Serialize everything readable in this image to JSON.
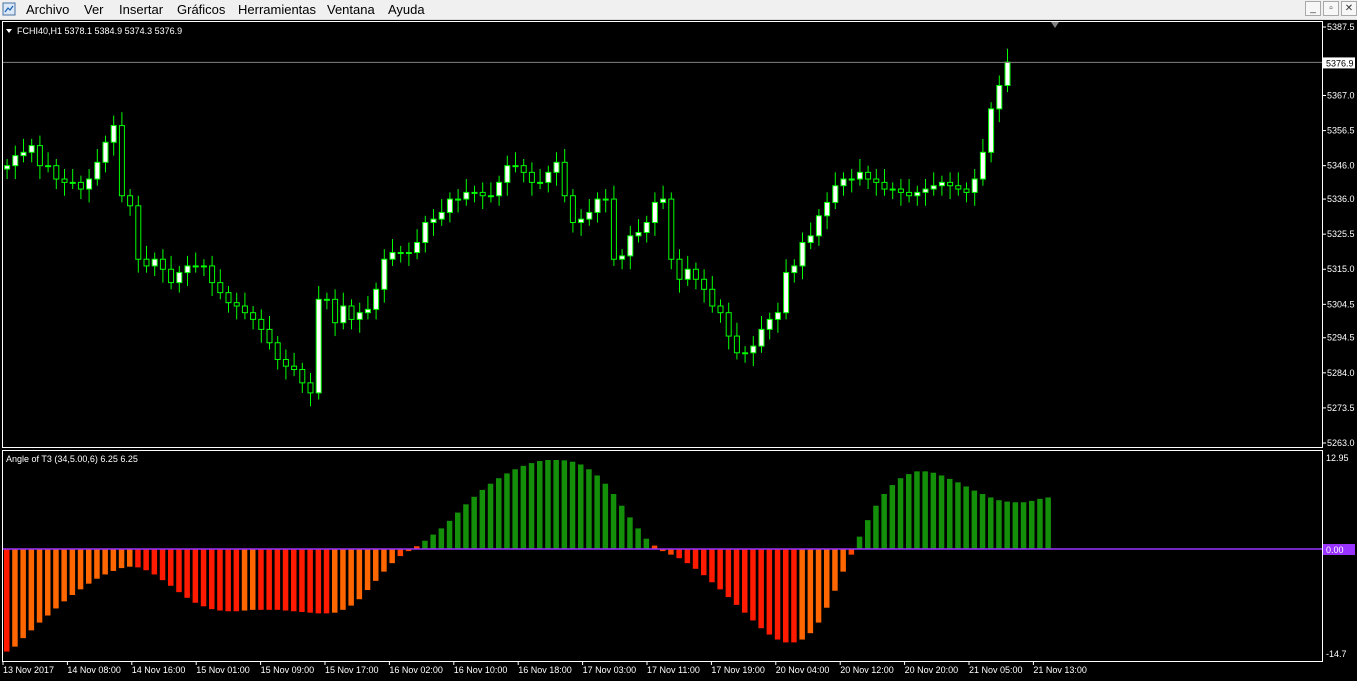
{
  "menu": {
    "items": [
      "Archivo",
      "Ver",
      "Insertar",
      "Gráficos",
      "Herramientas",
      "Ventana",
      "Ayuda"
    ]
  },
  "window_controls": {
    "minimize": "_",
    "restore": "▫",
    "close": "✕"
  },
  "colors": {
    "background": "#000000",
    "bull_candle": "#ffffff",
    "bear_candle": "#000000",
    "candle_outline": "#00ff00",
    "bar_dark_red": "#ff1a00",
    "bar_orange_red": "#ff4500",
    "bar_orange": "#ff6600",
    "bar_green": "#138f0a",
    "zero_line": "#9933ff",
    "grid_line": "#ffffff"
  },
  "price_chart": {
    "symbol_label": "FCHI40,H1  5378.1 5384.9 5374.3 5376.9",
    "current_price": "5376.9",
    "price_labels": [
      "5387.5",
      "5367.0",
      "5356.5",
      "5346.0",
      "5336.0",
      "5325.5",
      "5315.0",
      "5304.5",
      "5294.5",
      "5284.0",
      "5273.5",
      "5263.0"
    ]
  },
  "indicator": {
    "label": "Angle of T3 (34,5.00,6) 6.25 6.25",
    "max_label": "12.95",
    "zero_label": "0.00",
    "min_label": "-14.7"
  },
  "time_labels": [
    "13 Nov 2017",
    "14 Nov 08:00",
    "14 Nov 16:00",
    "15 Nov 01:00",
    "15 Nov 09:00",
    "15 Nov 17:00",
    "16 Nov 02:00",
    "16 Nov 10:00",
    "16 Nov 18:00",
    "17 Nov 03:00",
    "17 Nov 11:00",
    "17 Nov 19:00",
    "20 Nov 04:00",
    "20 Nov 12:00",
    "20 Nov 20:00",
    "21 Nov 05:00",
    "21 Nov 13:00"
  ],
  "chart_data": [
    {
      "type": "candlestick",
      "series": [
        {
          "name": "FCHI40,H1",
          "close": [
            5346,
            5349,
            5350,
            5352,
            5346,
            5346,
            5342,
            5341,
            5341,
            5339,
            5342,
            5347,
            5353,
            5358,
            5337,
            5334,
            5318,
            5316,
            5318,
            5315,
            5311,
            5314,
            5316,
            5316,
            5316,
            5311,
            5308,
            5305,
            5304,
            5302,
            5300,
            5297,
            5293,
            5288,
            5286,
            5285,
            5281,
            5278,
            5306,
            5306,
            5299,
            5304,
            5300,
            5302,
            5303,
            5309,
            5318,
            5320,
            5320,
            5320,
            5323,
            5329,
            5330,
            5332,
            5336,
            5336,
            5338,
            5338,
            5337,
            5337,
            5341,
            5346,
            5346,
            5344,
            5341,
            5341,
            5344,
            5347,
            5337,
            5329,
            5330,
            5332,
            5336,
            5336,
            5318,
            5319,
            5325,
            5326,
            5329,
            5335,
            5336,
            5318,
            5312,
            5315,
            5312,
            5309,
            5304,
            5302,
            5295,
            5290,
            5290,
            5292,
            5297,
            5300,
            5302,
            5314,
            5316,
            5323,
            5325,
            5331,
            5335,
            5340,
            5342,
            5342,
            5344,
            5342,
            5341,
            5339,
            5339,
            5338,
            5337,
            5338,
            5339,
            5340,
            5341,
            5340,
            5339,
            5338,
            5342,
            5350,
            5363,
            5370,
            5377
          ]
        }
      ],
      "ylim": [
        5263.0,
        5387.5
      ]
    },
    {
      "type": "bar",
      "series": [
        {
          "name": "Angle of T3",
          "values": [
            -14.5,
            -13.8,
            -12.6,
            -11.5,
            -10.4,
            -9.4,
            -8.4,
            -7.4,
            -6.5,
            -5.7,
            -4.9,
            -4.2,
            -3.6,
            -3.1,
            -2.7,
            -2.5,
            -2.6,
            -3.0,
            -3.6,
            -4.4,
            -5.2,
            -6.1,
            -6.9,
            -7.6,
            -8.1,
            -8.5,
            -8.7,
            -8.8,
            -8.8,
            -8.7,
            -8.6,
            -8.6,
            -8.6,
            -8.6,
            -8.7,
            -8.8,
            -8.9,
            -9.0,
            -9.1,
            -9.1,
            -9.0,
            -8.6,
            -8.0,
            -7.1,
            -5.8,
            -4.5,
            -3.2,
            -2.0,
            -1.0,
            -0.3,
            0.4,
            1.2,
            2.1,
            3.0,
            4.1,
            5.3,
            6.5,
            7.6,
            8.6,
            9.5,
            10.3,
            11.0,
            11.6,
            12.1,
            12.5,
            12.8,
            12.95,
            12.95,
            12.9,
            12.7,
            12.3,
            11.6,
            10.7,
            9.5,
            8.0,
            6.3,
            4.6,
            3.0,
            1.5,
            0.5,
            -0.3,
            -0.8,
            -1.3,
            -2.0,
            -2.8,
            -3.7,
            -4.7,
            -5.7,
            -6.8,
            -7.9,
            -9.0,
            -10.1,
            -11.2,
            -12.1,
            -12.8,
            -13.2,
            -13.2,
            -12.8,
            -11.9,
            -10.4,
            -8.3,
            -5.9,
            -3.2,
            -0.8,
            1.8,
            4.2,
            6.3,
            8.0,
            9.3,
            10.3,
            10.9,
            11.3,
            11.3,
            11.1,
            10.7,
            10.2,
            9.7,
            9.1,
            8.5,
            8.0,
            7.5,
            7.1,
            6.9,
            6.8,
            6.8,
            7.0,
            7.3,
            7.5
          ]
        }
      ],
      "ylim": [
        -14.7,
        12.95
      ]
    }
  ]
}
